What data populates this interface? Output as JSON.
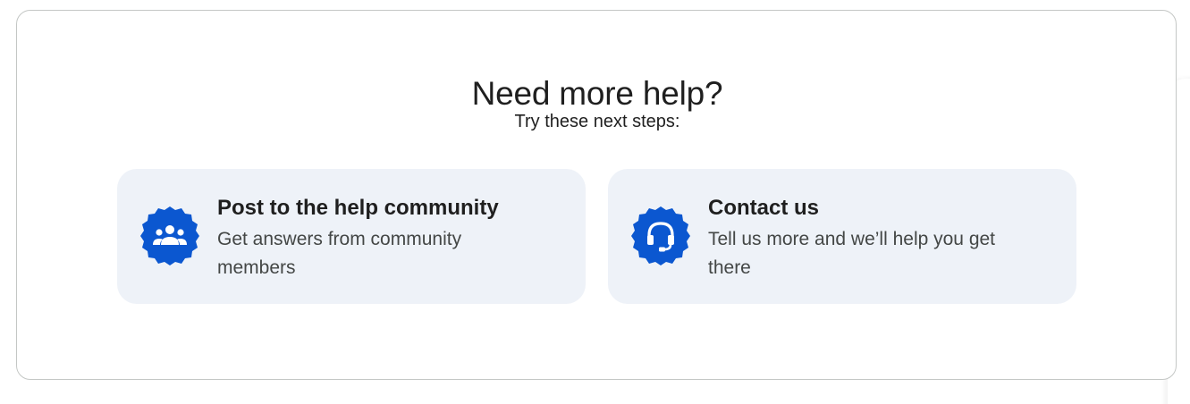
{
  "help_section": {
    "title": "Need more help?",
    "subtitle": "Try these next steps:",
    "accent_color": "#0b57d0",
    "card_background": "#eef2f8",
    "cards": [
      {
        "icon": "community-icon",
        "title": "Post to the help community",
        "description": "Get answers from community members"
      },
      {
        "icon": "headset-icon",
        "title": "Contact us",
        "description": "Tell us more and we’ll help you get there"
      }
    ]
  }
}
